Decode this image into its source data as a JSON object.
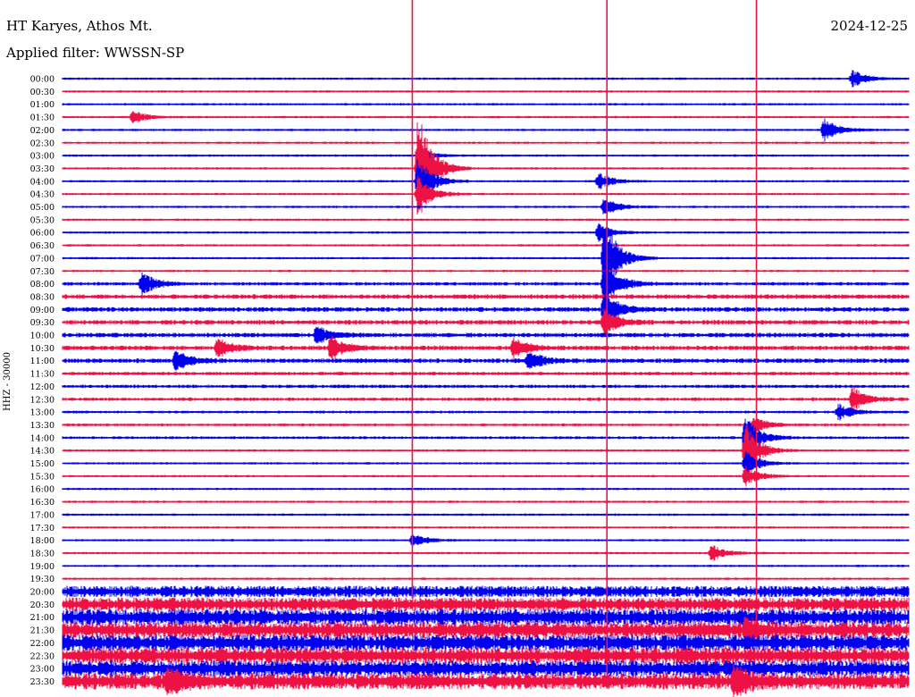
{
  "header": {
    "station": "HT Karyes, Athos Mt.",
    "date": "2024-12-25",
    "filter": "Applied filter: WWSSN-SP",
    "channel": "HHZ - 30000"
  },
  "chart_data": {
    "type": "helicorder",
    "title": "HT Karyes, Athos Mt.",
    "date": "2024-12-25",
    "ylabel": "HHZ - 30000",
    "row_labels": [
      "00:00",
      "00:30",
      "01:00",
      "01:30",
      "02:00",
      "02:30",
      "03:00",
      "03:30",
      "04:00",
      "04:30",
      "05:00",
      "05:30",
      "06:00",
      "06:30",
      "07:00",
      "07:30",
      "08:00",
      "08:30",
      "09:00",
      "09:30",
      "10:00",
      "10:30",
      "11:00",
      "11:30",
      "12:00",
      "12:30",
      "13:00",
      "13:30",
      "14:00",
      "14:30",
      "15:00",
      "15:30",
      "16:00",
      "16:30",
      "17:00",
      "17:30",
      "18:00",
      "18:30",
      "19:00",
      "19:30",
      "20:00",
      "20:30",
      "21:00",
      "21:30",
      "22:00",
      "22:30",
      "23:00",
      "23:30"
    ],
    "row_minutes": 30,
    "colors": [
      "#0000ee",
      "#ee1144"
    ],
    "noise_level": [
      1,
      1,
      1,
      1,
      1,
      1,
      1,
      1,
      1,
      1,
      1,
      1,
      1,
      1,
      1,
      1,
      1.5,
      2,
      2,
      2,
      2,
      2,
      2,
      1.5,
      1.5,
      1.5,
      1.2,
      1.2,
      1.2,
      1,
      1,
      1,
      1,
      1,
      1,
      1,
      1,
      1,
      1,
      1,
      5,
      6,
      7,
      7,
      7,
      7,
      7,
      7
    ],
    "events": [
      {
        "row": 0,
        "x_min": 28.0,
        "amp": 10
      },
      {
        "row": 3,
        "x_min": 2.5,
        "amp": 8
      },
      {
        "row": 4,
        "x_min": 27.0,
        "amp": 14
      },
      {
        "row": 7,
        "x_min": 12.6,
        "amp": 70
      },
      {
        "row": 8,
        "x_min": 12.6,
        "amp": 30
      },
      {
        "row": 9,
        "x_min": 12.6,
        "amp": 22
      },
      {
        "row": 6,
        "x_min": 12.6,
        "amp": 8
      },
      {
        "row": 8,
        "x_min": 19.0,
        "amp": 10
      },
      {
        "row": 12,
        "x_min": 19.0,
        "amp": 10
      },
      {
        "row": 14,
        "x_min": 19.2,
        "amp": 50
      },
      {
        "row": 16,
        "x_min": 19.2,
        "amp": 30
      },
      {
        "row": 18,
        "x_min": 19.2,
        "amp": 22
      },
      {
        "row": 19,
        "x_min": 19.2,
        "amp": 16
      },
      {
        "row": 10,
        "x_min": 19.2,
        "amp": 12
      },
      {
        "row": 16,
        "x_min": 2.8,
        "amp": 14
      },
      {
        "row": 21,
        "x_min": 5.5,
        "amp": 12
      },
      {
        "row": 22,
        "x_min": 4.0,
        "amp": 12
      },
      {
        "row": 20,
        "x_min": 9.0,
        "amp": 10
      },
      {
        "row": 21,
        "x_min": 9.5,
        "amp": 14
      },
      {
        "row": 21,
        "x_min": 16.0,
        "amp": 12
      },
      {
        "row": 22,
        "x_min": 16.5,
        "amp": 12
      },
      {
        "row": 25,
        "x_min": 28.0,
        "amp": 14
      },
      {
        "row": 26,
        "x_min": 27.5,
        "amp": 10
      },
      {
        "row": 27,
        "x_min": 24.5,
        "amp": 10
      },
      {
        "row": 29,
        "x_min": 24.2,
        "amp": 32
      },
      {
        "row": 28,
        "x_min": 24.2,
        "amp": 26
      },
      {
        "row": 30,
        "x_min": 24.2,
        "amp": 16
      },
      {
        "row": 31,
        "x_min": 24.2,
        "amp": 12
      },
      {
        "row": 43,
        "x_min": 24.2,
        "amp": 10
      },
      {
        "row": 36,
        "x_min": 12.4,
        "amp": 8
      },
      {
        "row": 37,
        "x_min": 23.0,
        "amp": 10
      },
      {
        "row": 47,
        "x_min": 3.7,
        "amp": 14
      },
      {
        "row": 47,
        "x_min": 23.8,
        "amp": 16
      }
    ],
    "spikes": [
      {
        "x_min": 12.4,
        "from_row": -1,
        "to_row": 40
      },
      {
        "x_min": 19.3,
        "from_row": -1,
        "to_row": 47
      },
      {
        "x_min": 24.6,
        "from_row": -1,
        "to_row": 43
      }
    ]
  }
}
